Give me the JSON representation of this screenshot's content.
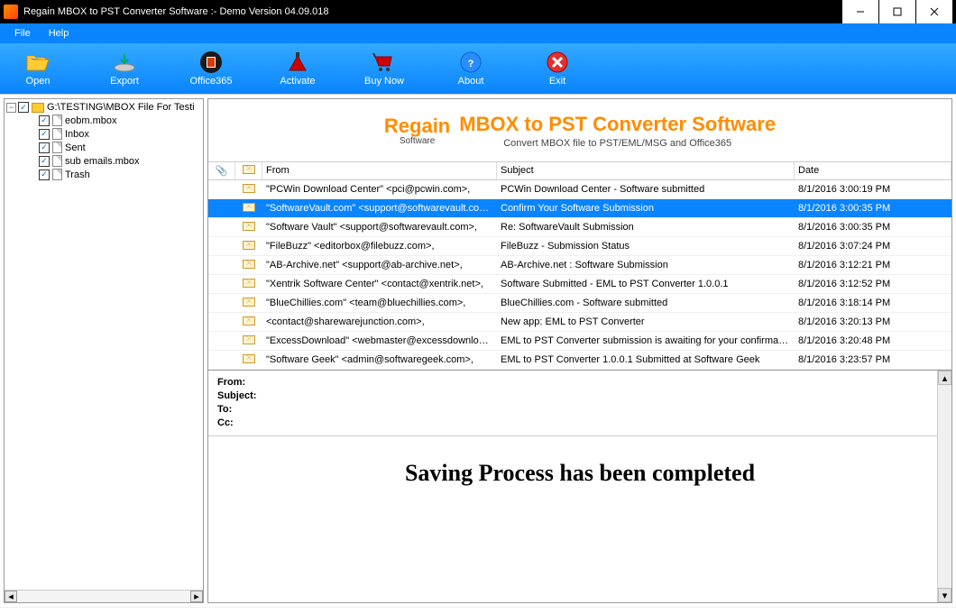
{
  "window": {
    "title": "Regain MBOX to PST Converter Software :-  Demo Version 04.09.018"
  },
  "menu": {
    "file": "File",
    "help": "Help"
  },
  "toolbar": {
    "open": "Open",
    "export": "Export",
    "office365": "Office365",
    "activate": "Activate",
    "buynow": "Buy Now",
    "about": "About",
    "exit": "Exit"
  },
  "tree": {
    "root": "G:\\TESTING\\MBOX File For Testi",
    "items": [
      {
        "label": "eobm.mbox"
      },
      {
        "label": "Inbox"
      },
      {
        "label": "Sent"
      },
      {
        "label": "sub emails.mbox"
      },
      {
        "label": "Trash"
      }
    ]
  },
  "banner": {
    "logo_top": "Regain",
    "logo_bottom": "Software",
    "title": "MBOX to PST Converter Software",
    "subtitle": "Convert MBOX file to PST/EML/MSG and Office365"
  },
  "grid": {
    "headers": {
      "attach": "📎",
      "from": "From",
      "subject": "Subject",
      "date": "Date"
    },
    "rows": [
      {
        "from": "\"PCWin Download Center\" <pci@pcwin.com>,",
        "subject": "PCWin Download Center - Software submitted",
        "date": "8/1/2016 3:00:19 PM",
        "sel": false
      },
      {
        "from": "\"SoftwareVault.com\" <support@softwarevault.com>,",
        "subject": "Confirm Your Software Submission",
        "date": "8/1/2016 3:00:35 PM",
        "sel": true
      },
      {
        "from": "\"Software Vault\" <support@softwarevault.com>,",
        "subject": "Re: SoftwareVault Submission",
        "date": "8/1/2016 3:00:35 PM",
        "sel": false
      },
      {
        "from": "\"FileBuzz\" <editorbox@filebuzz.com>,",
        "subject": "FileBuzz - Submission Status",
        "date": "8/1/2016 3:07:24 PM",
        "sel": false
      },
      {
        "from": "\"AB-Archive.net\" <support@ab-archive.net>,",
        "subject": "AB-Archive.net : Software Submission",
        "date": "8/1/2016 3:12:21 PM",
        "sel": false
      },
      {
        "from": "\"Xentrik Software Center\" <contact@xentrik.net>,",
        "subject": "Software Submitted - EML to PST Converter 1.0.0.1",
        "date": "8/1/2016 3:12:52 PM",
        "sel": false
      },
      {
        "from": "\"BlueChillies.com\" <team@bluechillies.com>,",
        "subject": "BlueChillies.com - Software submitted",
        "date": "8/1/2016 3:18:14 PM",
        "sel": false
      },
      {
        "from": "<contact@sharewarejunction.com>,",
        "subject": "New app: EML to PST Converter",
        "date": "8/1/2016 3:20:13 PM",
        "sel": false
      },
      {
        "from": "\"ExcessDownload\" <webmaster@excessdownload....",
        "subject": "EML to PST Converter submission is awaiting for your confirmation a",
        "date": "8/1/2016 3:20:48 PM",
        "sel": false
      },
      {
        "from": "\"Software Geek\" <admin@softwaregeek.com>,",
        "subject": "EML to PST Converter 1.0.0.1 Submitted at Software Geek",
        "date": "8/1/2016 3:23:57 PM",
        "sel": false
      }
    ]
  },
  "preview": {
    "from": "From:",
    "subject": "Subject:",
    "to": "To:",
    "cc": "Cc:",
    "message": "Saving Process has been completed"
  }
}
